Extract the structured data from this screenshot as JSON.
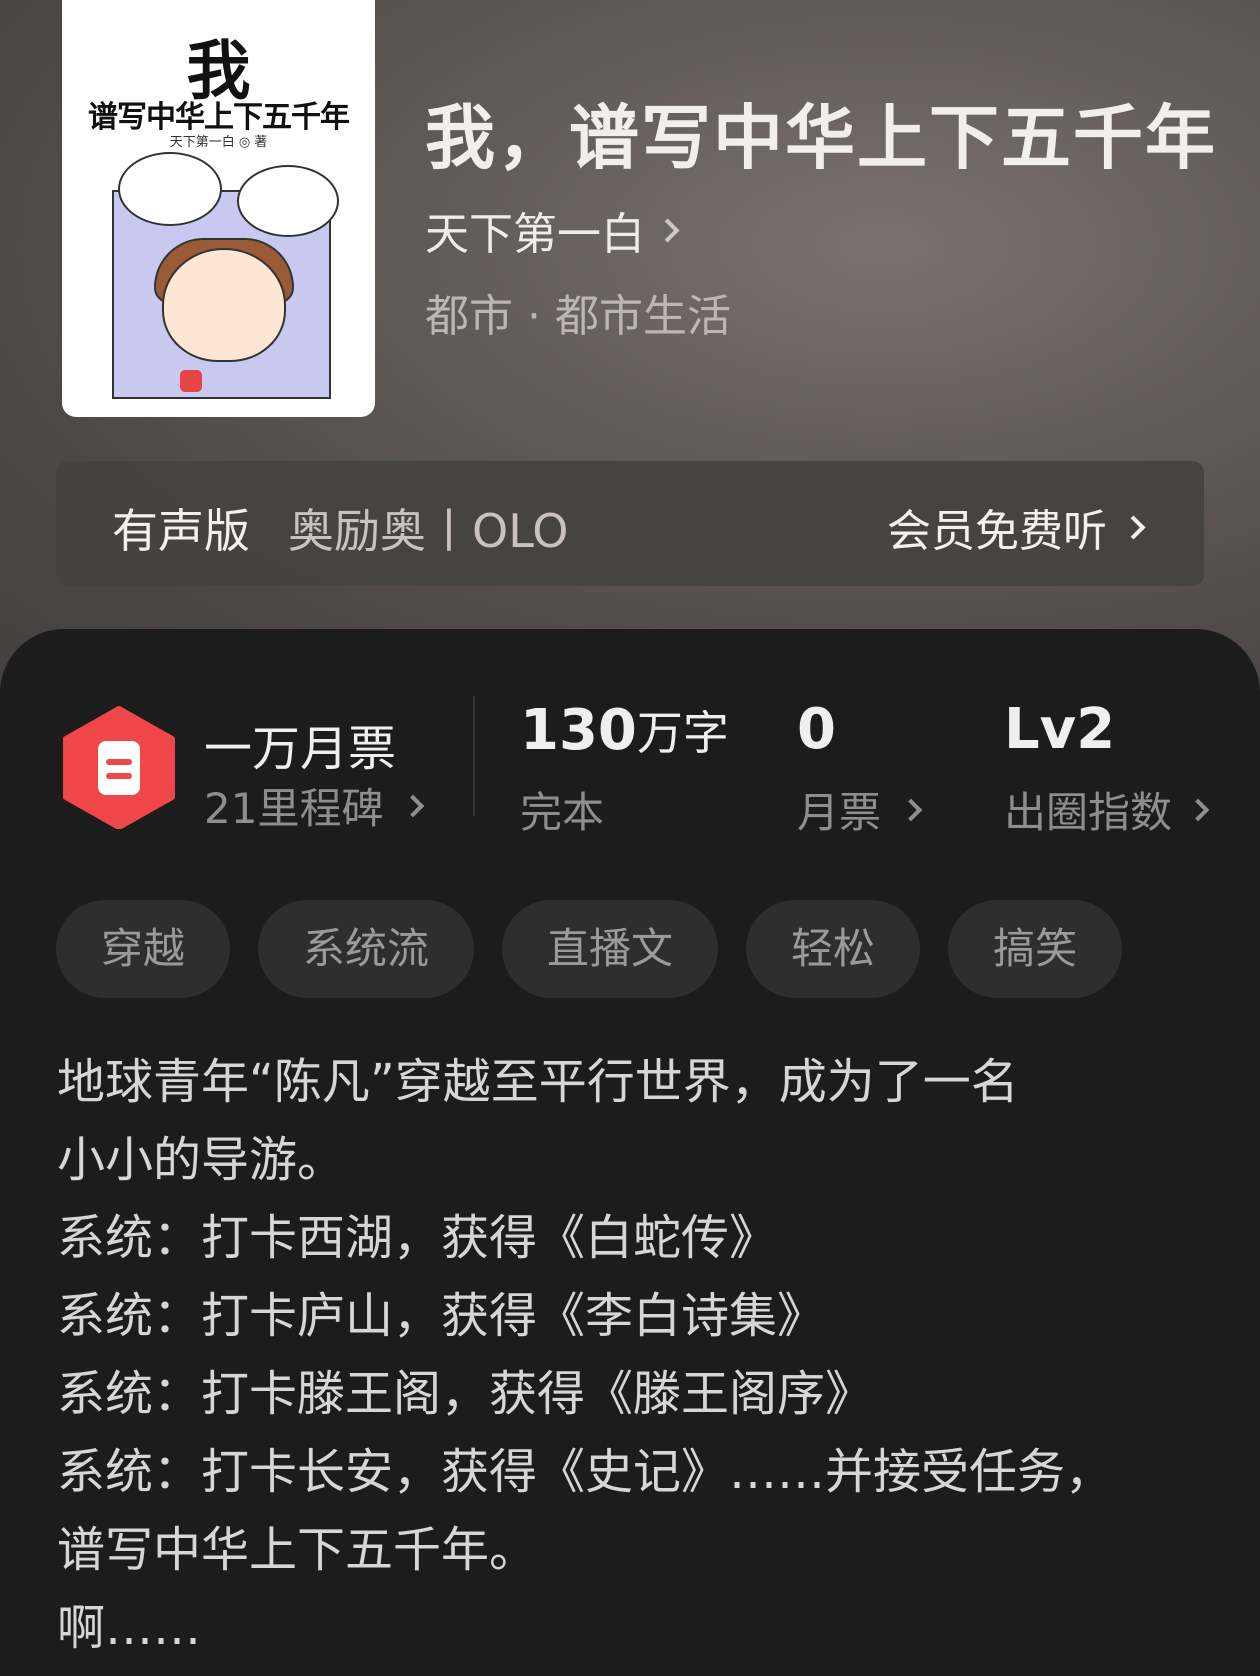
{
  "book": {
    "title": "我，谱写中华上下五千年",
    "author": "天下第一白",
    "genre": "都市 · 都市生活",
    "cover": {
      "title_big": "我",
      "title_small": "谱写中华上下五千年",
      "author_line": "天下第一白 ◎ 著"
    }
  },
  "audio": {
    "label": "有声版",
    "narrator": "奥励奥丨OLO",
    "free_listen": "会员免费听"
  },
  "stats": {
    "ticket_title": "一万月票",
    "ticket_sub": "21里程碑",
    "words_num": "130",
    "words_unit": "万字",
    "words_sub": "完本",
    "monthly_votes_num": "0",
    "monthly_votes_sub": "月票",
    "level_num": "Lv2",
    "level_sub": "出圈指数"
  },
  "tags": [
    "穿越",
    "系统流",
    "直播文",
    "轻松",
    "搞笑"
  ],
  "synopsis": [
    "地球青年“陈凡”穿越至平行世界，成为了一名",
    "小小的导游。",
    "系统：打卡西湖，获得《白蛇传》",
    "系统：打卡庐山，获得《李白诗集》",
    "系统：打卡滕王阁，获得《滕王阁序》",
    "系统：打卡长安，获得《史记》……并接受任务，",
    "谱写中华上下五千年。",
    "啊……"
  ],
  "colors": {
    "panel_bg": "#1c1c1c",
    "ticket_red": "#f04848",
    "tag_bg": "#2e2e2e"
  },
  "icons": [
    "chevron-right-icon",
    "monthly-ticket-icon"
  ]
}
